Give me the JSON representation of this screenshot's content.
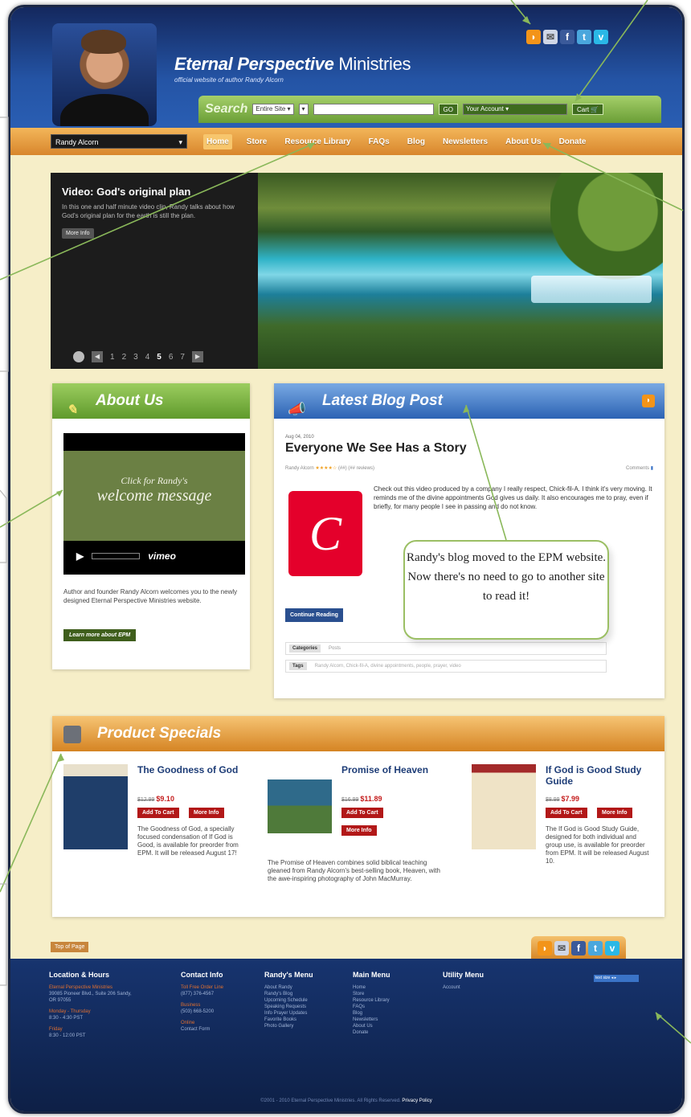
{
  "header": {
    "title_bold": "Eternal Perspective",
    "title_rest": " Ministries",
    "subtitle": "official website of author Randy Alcorn"
  },
  "search": {
    "label": "Search",
    "scope": "Entire Site",
    "go": "GO",
    "account": "Your Account",
    "cart": "Cart"
  },
  "nav": {
    "user_select": "Randy Alcorn",
    "items": [
      "Home",
      "Store",
      "Resource Library",
      "FAQs",
      "Blog",
      "Newsletters",
      "About Us",
      "Donate"
    ]
  },
  "slider": {
    "heading": "Video: God's original plan",
    "desc": "In this one and half minute video clip, Randy talks about how God's original plan for the earth is still the plan.",
    "more": "More Info",
    "pages": [
      "1",
      "2",
      "3",
      "4",
      "5",
      "6",
      "7"
    ],
    "current": "5"
  },
  "about": {
    "heading": "About Us",
    "video_line1": "Click for Randy's",
    "video_line2": "welcome message",
    "vimeo": "vimeo",
    "text": "Author and founder Randy Alcorn welcomes you to the newly designed Eternal Perspective Ministries website.",
    "button": "Learn more about EPM"
  },
  "blog": {
    "heading": "Latest Blog Post",
    "date": "Aug 04, 2010",
    "title": "Everyone We See Has a Story",
    "author": "Randy Alcorn",
    "stars": "★★★★☆",
    "reviews": "(##) (## reviews)",
    "comments": "Comments",
    "body": "Check out this video produced by a company I really respect, Chick-fil-A. I think it's very moving. It reminds me of the divine appointments God gives us daily. It also encourages me to pray, even if briefly, for many people I see in passing and do not know.",
    "continue": "Continue Reading",
    "categories_label": "Categories",
    "categories_value": "Posts",
    "tags_label": "Tags",
    "tags_value": "Randy Alcorn, Chick-fil-A, divine appointments, people, prayer, video"
  },
  "bubble": "Randy's blog moved to the EPM website. Now there's no need to go to another site to read it!",
  "specials": {
    "heading": "Product Specials",
    "products": [
      {
        "name": "The Goodness of God",
        "old": "$12.99",
        "price": "$9.10",
        "desc": "The Goodness of God, a specially focused condensation of If God is Good, is available for preorder from EPM. It will be released August 17!"
      },
      {
        "name": "Promise of Heaven",
        "old": "$16.99",
        "price": "$11.89",
        "desc": "The Promise of Heaven combines solid biblical teaching gleaned from Randy Alcorn's best-selling book, Heaven, with the awe-inspiring photography of John MacMurray."
      },
      {
        "name": "If God is Good Study Guide",
        "old": "$8.99",
        "price": "$7.99",
        "desc": "The If God is Good Study Guide, designed for both individual and group use, is available for preorder from EPM. It will be released August 10."
      }
    ],
    "add_to_cart": "Add To Cart",
    "more_info": "More Info"
  },
  "back_top": "Top of Page",
  "footer": {
    "col1": {
      "h": "Location & Hours",
      "org": "Eternal Perspective Ministries",
      "addr": "39085 Pioneer Blvd., Suite 206 Sandy, OR 97055",
      "days1": "Monday - Thursday",
      "hours1": "8:30 - 4:30 PST",
      "days2": "Friday",
      "hours2": "8:30 - 12:00 PST"
    },
    "col2": {
      "h": "Contact Info",
      "tollfree": "Toll Free Order Line",
      "phone1": "(877) 376-4567",
      "bus": "Business",
      "phone2": "(503) 668-5200",
      "online": "Online",
      "contact": "Contact Form"
    },
    "col3": {
      "h": "Randy's Menu",
      "items": [
        "About Randy",
        "Randy's Blog",
        "Upcoming Schedule",
        "Speaking Requests",
        "Info Prayer Updates",
        "Favorite Books",
        "Photo Gallery"
      ]
    },
    "col4": {
      "h": "Main Menu",
      "items": [
        "Home",
        "Store",
        "Resource Library",
        "FAQs",
        "Blog",
        "Newsletters",
        "About Us",
        "Donate"
      ]
    },
    "col5": {
      "h": "Utility Menu",
      "items": [
        "Account"
      ]
    },
    "text_size": "text size",
    "copyright": "©2001 - 2010 Eternal Perspective Ministries. All Rights Reserved.",
    "privacy": "Privacy Policy"
  },
  "colors": {
    "header_blue": "#2454a5",
    "nav_orange": "#d8862c",
    "search_green": "#6a9e36",
    "annotation": "#8ab85a",
    "footer": "#0d1f45"
  }
}
